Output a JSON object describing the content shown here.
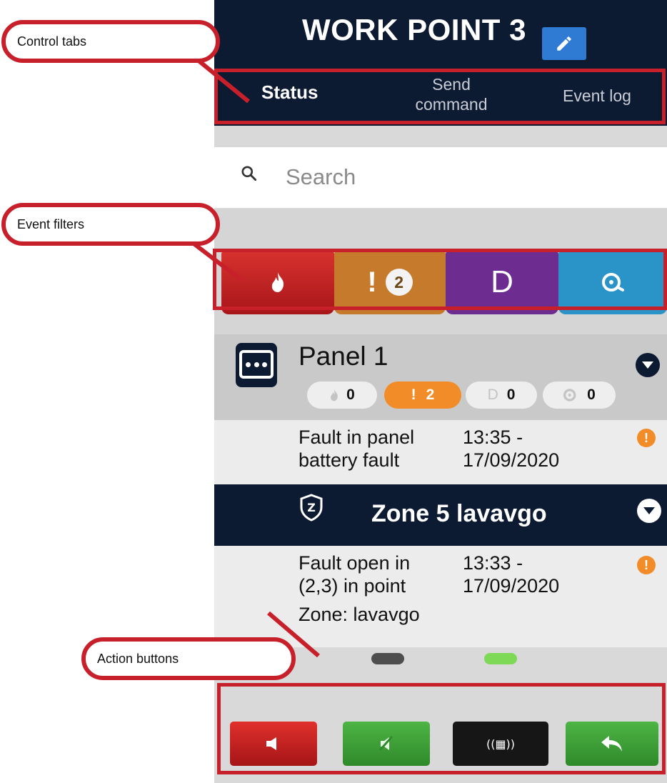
{
  "header": {
    "title": "WORK POINT 3",
    "edit_icon": "pencil-icon"
  },
  "tabs": [
    {
      "label": "Status",
      "active": true
    },
    {
      "label": "Send\ncommand",
      "line1": "Send",
      "line2": "command",
      "active": false
    },
    {
      "label": "Event log",
      "active": false
    }
  ],
  "search": {
    "placeholder": "Search",
    "value": "",
    "icon": "search-icon"
  },
  "filters": [
    {
      "icon": "flame-icon",
      "color": "#b8201f"
    },
    {
      "icon": "exclamation-icon",
      "count": "2",
      "color": "#c67a2c"
    },
    {
      "icon": "disable-icon",
      "label": "D",
      "color": "#6d2c8f"
    },
    {
      "icon": "siren-icon",
      "color": "#2a93c7"
    }
  ],
  "panel": {
    "title": "Panel 1",
    "chips": [
      {
        "icon": "flame-icon",
        "count": "0"
      },
      {
        "icon": "exclamation-icon",
        "symbol": "!",
        "count": "2",
        "color": "#f28c28"
      },
      {
        "icon": "disable-icon",
        "symbol": "D",
        "count": "0"
      },
      {
        "icon": "siren-icon",
        "count": "0"
      }
    ],
    "event": {
      "line1": "Fault in panel",
      "line2": "battery fault",
      "time1": "13:35 -",
      "time2": "17/09/2020",
      "status_icon": "warning-icon"
    }
  },
  "zone": {
    "title": "Zone 5 lavavgo",
    "event": {
      "line1": "Fault open in",
      "line2": "(2,3) in point",
      "line3": "Zone: lavavgo",
      "time1": "13:33 -",
      "time2": "17/09/2020",
      "status_icon": "warning-icon"
    }
  },
  "leds": [
    {
      "state": "off",
      "color": "#4e4e4e"
    },
    {
      "state": "off",
      "color": "#4e4e4e"
    },
    {
      "state": "on",
      "color": "#7ed957"
    }
  ],
  "actions": [
    {
      "icon": "mute-buzzer-icon",
      "color": "#c8201f"
    },
    {
      "icon": "silence-sirens-icon",
      "color": "#3e9a37"
    },
    {
      "icon": "reset-icon",
      "color": "#161616"
    },
    {
      "icon": "undo-icon",
      "color": "#3e9a37"
    }
  ],
  "callouts": {
    "control_tabs": "Control tabs",
    "event_filters": "Event filters",
    "action_buttons": "Action buttons"
  },
  "colors": {
    "header_bg": "#0c1a32",
    "callout_red": "#c8202a"
  }
}
